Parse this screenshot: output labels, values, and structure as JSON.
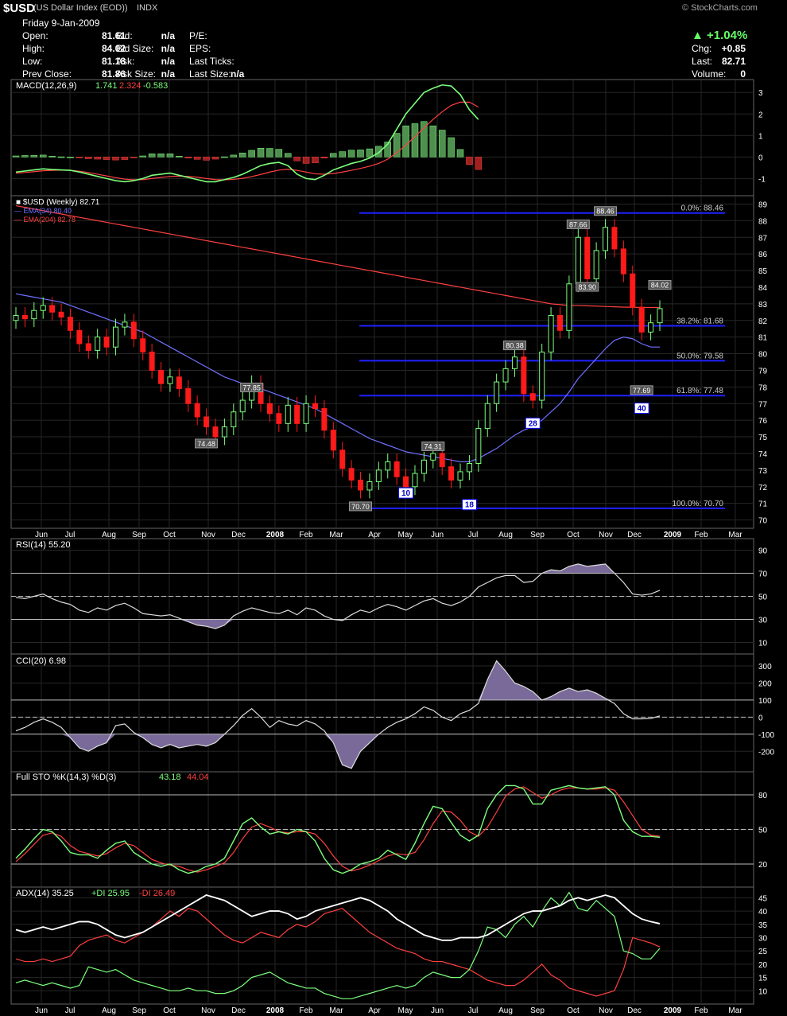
{
  "header": {
    "symbol": "$USD",
    "name": "(US Dollar Index (EOD))",
    "exchange": "INDX",
    "source": "© StockCharts.com",
    "date": "Friday  9-Jan-2009",
    "col1": [
      [
        "Open:",
        "81.61"
      ],
      [
        "High:",
        "84.02"
      ],
      [
        "Low:",
        "81.18"
      ],
      [
        "Prev Close:",
        "81.86"
      ]
    ],
    "col2": [
      [
        "Bid:",
        "n/a"
      ],
      [
        "Bid Size:",
        "n/a"
      ],
      [
        "Ask:",
        "n/a"
      ],
      [
        "Ask Size:",
        "n/a"
      ]
    ],
    "col3": [
      [
        "P/E:",
        ""
      ],
      [
        "EPS:",
        ""
      ],
      [
        "Last Ticks:",
        ""
      ],
      [
        "Last Size:",
        "n/a"
      ]
    ],
    "change_pct": "+1.04%",
    "right": [
      [
        "Chg:",
        "+0.85"
      ],
      [
        "Last:",
        "82.71"
      ],
      [
        "Volume:",
        "0"
      ]
    ]
  },
  "colors": {
    "up": "#7cff7c",
    "down": "#ff1a1a",
    "ema34": "#7070ff",
    "ema204": "#ff4040",
    "fib": "#2020ff",
    "purple": "#7a6a9a"
  },
  "chart_data": [
    {
      "type": "line",
      "title": "MACD(12,26,9)",
      "values_label": [
        "1.741",
        "2.324",
        "-0.583"
      ],
      "ylim": [
        -1.8,
        3.6
      ],
      "yticks": [
        -1,
        0,
        1,
        2,
        3
      ],
      "macd": [
        -0.7,
        -0.65,
        -0.6,
        -0.55,
        -0.58,
        -0.6,
        -0.62,
        -0.7,
        -0.8,
        -0.9,
        -1.0,
        -1.1,
        -1.15,
        -1.1,
        -1.0,
        -0.85,
        -0.8,
        -0.75,
        -0.85,
        -0.95,
        -1.05,
        -1.15,
        -1.15,
        -1.05,
        -0.95,
        -0.8,
        -0.6,
        -0.4,
        -0.3,
        -0.25,
        -0.4,
        -0.8,
        -1.0,
        -1.05,
        -0.85,
        -0.6,
        -0.45,
        -0.3,
        -0.2,
        -0.05,
        0.2,
        0.6,
        1.3,
        2.0,
        2.5,
        3.0,
        3.2,
        3.35,
        3.3,
        2.9,
        2.2,
        1.741
      ],
      "signal": [
        -0.75,
        -0.72,
        -0.68,
        -0.64,
        -0.62,
        -0.61,
        -0.62,
        -0.66,
        -0.72,
        -0.8,
        -0.88,
        -0.96,
        -1.03,
        -1.06,
        -1.05,
        -1.0,
        -0.95,
        -0.9,
        -0.89,
        -0.9,
        -0.94,
        -1.0,
        -1.05,
        -1.06,
        -1.04,
        -0.99,
        -0.91,
        -0.81,
        -0.7,
        -0.61,
        -0.57,
        -0.62,
        -0.7,
        -0.78,
        -0.8,
        -0.77,
        -0.7,
        -0.62,
        -0.53,
        -0.43,
        -0.3,
        -0.1,
        0.2,
        0.55,
        0.95,
        1.35,
        1.75,
        2.1,
        2.4,
        2.55,
        2.55,
        2.324
      ]
    },
    {
      "type": "candlestick",
      "title": "$USD (Weekly) 82.71",
      "series": [
        {
          "name": "EMA(34) 80.40",
          "color": "#7070ff"
        },
        {
          "name": "EMA(204) 82.78",
          "color": "#ff4040"
        }
      ],
      "ylim": [
        69.5,
        89.5
      ],
      "yticks": [
        70,
        71,
        72,
        73,
        74,
        75,
        76,
        77,
        78,
        79,
        80,
        81,
        82,
        83,
        84,
        85,
        86,
        87,
        88,
        89
      ],
      "xticks": [
        "Jun",
        "Jul",
        "Aug",
        "Sep",
        "Oct",
        "Nov",
        "Dec",
        "2008",
        "Feb",
        "Mar",
        "Apr",
        "May",
        "Jun",
        "Jul",
        "Aug",
        "Sep",
        "Oct",
        "Nov",
        "Dec",
        "2009",
        "Feb",
        "Mar"
      ],
      "closes": [
        82.3,
        82.1,
        82.6,
        82.9,
        82.5,
        82.2,
        81.4,
        80.6,
        80.2,
        81.0,
        80.4,
        81.6,
        81.9,
        80.9,
        80.1,
        79.0,
        78.2,
        78.6,
        77.9,
        77.0,
        76.2,
        75.6,
        75.0,
        75.6,
        76.5,
        77.2,
        78.2,
        77.0,
        76.4,
        75.8,
        76.9,
        75.8,
        77.0,
        76.7,
        75.4,
        74.2,
        73.1,
        72.4,
        71.8,
        72.3,
        73.0,
        73.5,
        72.6,
        72.0,
        72.8,
        73.6,
        74.0,
        73.2,
        72.4,
        72.9,
        73.4,
        75.5,
        77.0,
        78.3,
        79.1,
        79.8,
        77.6,
        77.2,
        80.1,
        82.3,
        81.4,
        84.2,
        87.0,
        84.5,
        86.2,
        87.6,
        86.3,
        84.8,
        82.8,
        81.3,
        81.86,
        82.71
      ],
      "ema34": [
        83.6,
        83.5,
        83.4,
        83.3,
        83.2,
        83.1,
        82.9,
        82.7,
        82.5,
        82.3,
        82.1,
        81.9,
        81.7,
        81.5,
        81.3,
        81.0,
        80.7,
        80.4,
        80.1,
        79.8,
        79.5,
        79.2,
        78.9,
        78.6,
        78.4,
        78.2,
        78.1,
        77.9,
        77.7,
        77.5,
        77.3,
        77.1,
        76.9,
        76.7,
        76.4,
        76.1,
        75.8,
        75.5,
        75.2,
        74.9,
        74.7,
        74.5,
        74.3,
        74.1,
        74.0,
        73.9,
        73.8,
        73.7,
        73.6,
        73.5,
        73.5,
        73.7,
        74.0,
        74.3,
        74.7,
        75.1,
        75.4,
        75.6,
        76.0,
        76.5,
        77.0,
        77.7,
        78.5,
        79.1,
        79.7,
        80.3,
        80.8,
        81.0,
        80.9,
        80.6,
        80.4,
        80.4
      ],
      "ema204": [
        88.9,
        88.8,
        88.7,
        88.6,
        88.5,
        88.4,
        88.3,
        88.2,
        88.1,
        88.0,
        87.9,
        87.8,
        87.7,
        87.6,
        87.5,
        87.4,
        87.3,
        87.2,
        87.1,
        87.0,
        86.9,
        86.8,
        86.7,
        86.6,
        86.5,
        86.4,
        86.3,
        86.2,
        86.1,
        86.0,
        85.9,
        85.8,
        85.7,
        85.6,
        85.5,
        85.4,
        85.3,
        85.2,
        85.1,
        85.0,
        84.9,
        84.8,
        84.7,
        84.6,
        84.5,
        84.4,
        84.3,
        84.2,
        84.1,
        84.0,
        83.9,
        83.8,
        83.7,
        83.6,
        83.5,
        83.4,
        83.3,
        83.2,
        83.1,
        83.0,
        82.95,
        82.9,
        82.9,
        82.88,
        82.86,
        82.84,
        82.82,
        82.8,
        82.79,
        82.78,
        82.78,
        82.78
      ],
      "fib_levels": [
        {
          "label": "0.0%: 88.46",
          "value": 88.46
        },
        {
          "label": "38.2%: 81.68",
          "value": 81.68
        },
        {
          "label": "50.0%: 79.58",
          "value": 79.58
        },
        {
          "label": "61.8%: 77.48",
          "value": 77.48
        },
        {
          "label": "100.0%: 70.70",
          "value": 70.7
        }
      ],
      "annotations": [
        {
          "text": "77.85",
          "idx": 26,
          "value": 77.85
        },
        {
          "text": "74.48",
          "idx": 21,
          "value": 74.48
        },
        {
          "text": "70.70",
          "idx": 38,
          "value": 70.7
        },
        {
          "text": "74.31",
          "idx": 46,
          "value": 74.31
        },
        {
          "text": "80.38",
          "idx": 55,
          "value": 80.38
        },
        {
          "text": "87.66",
          "idx": 62,
          "value": 87.66
        },
        {
          "text": "88.46",
          "idx": 65,
          "value": 88.46
        },
        {
          "text": "83.90",
          "idx": 63,
          "value": 83.9
        },
        {
          "text": "84.02",
          "idx": 71,
          "value": 84.02
        },
        {
          "text": "77.69",
          "idx": 69,
          "value": 77.69
        }
      ],
      "markers": [
        {
          "text": "10",
          "idx": 43,
          "value": 71.6
        },
        {
          "text": "18",
          "idx": 50,
          "value": 70.9
        },
        {
          "text": "28",
          "idx": 57,
          "value": 75.8
        },
        {
          "text": "40",
          "idx": 69,
          "value": 76.7
        }
      ]
    },
    {
      "type": "line",
      "title": "RSI(14)",
      "value_label": "55.20",
      "ylim": [
        0,
        100
      ],
      "yticks": [
        10,
        30,
        50,
        70,
        90
      ],
      "values": [
        49,
        48,
        50,
        52,
        48,
        45,
        43,
        38,
        36,
        40,
        38,
        42,
        44,
        40,
        35,
        34,
        33,
        34,
        31,
        28,
        25,
        24,
        22,
        25,
        33,
        37,
        40,
        38,
        36,
        35,
        38,
        34,
        40,
        38,
        33,
        30,
        29,
        34,
        38,
        36,
        40,
        43,
        41,
        38,
        42,
        46,
        48,
        44,
        42,
        45,
        50,
        58,
        62,
        66,
        68,
        68,
        62,
        63,
        70,
        73,
        72,
        76,
        78,
        76,
        77,
        78,
        70,
        62,
        52,
        51,
        52,
        55.2
      ]
    },
    {
      "type": "line",
      "title": "CCI(20)",
      "value_label": "6.98",
      "ylim": [
        -320,
        370
      ],
      "yticks": [
        -200,
        -100,
        0,
        100,
        200,
        300
      ],
      "values": [
        -80,
        -60,
        -30,
        -10,
        -30,
        -60,
        -120,
        -180,
        -200,
        -170,
        -150,
        -50,
        -40,
        -90,
        -120,
        -160,
        -180,
        -160,
        -180,
        -170,
        -160,
        -170,
        -150,
        -100,
        -50,
        10,
        50,
        0,
        -60,
        -20,
        -40,
        -50,
        -20,
        -40,
        -80,
        -150,
        -280,
        -300,
        -200,
        -150,
        -100,
        -60,
        -30,
        -10,
        20,
        60,
        40,
        0,
        -20,
        20,
        40,
        80,
        220,
        330,
        270,
        200,
        180,
        150,
        100,
        120,
        150,
        170,
        150,
        160,
        140,
        110,
        80,
        20,
        -10,
        -10,
        -8,
        6.98
      ]
    },
    {
      "type": "line",
      "title": "Full STO %K(14,3) %D(3)",
      "values_label": [
        "43.18",
        "44.04"
      ],
      "ylim": [
        0,
        100
      ],
      "yticks": [
        20,
        50,
        80
      ],
      "k": [
        25,
        33,
        42,
        50,
        48,
        40,
        30,
        28,
        28,
        25,
        32,
        38,
        40,
        30,
        25,
        20,
        18,
        20,
        15,
        12,
        14,
        18,
        20,
        25,
        40,
        55,
        60,
        52,
        46,
        48,
        46,
        50,
        48,
        40,
        25,
        15,
        12,
        15,
        20,
        22,
        25,
        32,
        28,
        24,
        38,
        55,
        70,
        68,
        56,
        45,
        40,
        45,
        68,
        80,
        88,
        88,
        85,
        72,
        72,
        84,
        86,
        88,
        86,
        85,
        86,
        87,
        80,
        58,
        48,
        44,
        44,
        43.18
      ],
      "d": [
        22,
        29,
        37,
        45,
        47,
        44,
        36,
        31,
        29,
        27,
        29,
        34,
        38,
        36,
        30,
        24,
        21,
        19,
        18,
        15,
        13,
        15,
        18,
        21,
        30,
        42,
        52,
        55,
        52,
        48,
        47,
        48,
        48,
        46,
        38,
        27,
        18,
        14,
        16,
        19,
        23,
        27,
        29,
        28,
        30,
        41,
        55,
        66,
        65,
        58,
        48,
        44,
        52,
        65,
        79,
        85,
        87,
        82,
        77,
        80,
        84,
        86,
        86,
        85,
        85,
        86,
        84,
        74,
        62,
        50,
        45,
        44.04
      ]
    },
    {
      "type": "line",
      "title": "ADX(14)",
      "values_label": [
        "35.25",
        "25.95",
        "26.49"
      ],
      "series": [
        {
          "name": "+DI",
          "color": "#7cff7c"
        },
        {
          "name": "-DI",
          "color": "#ff4040"
        }
      ],
      "ylim": [
        5,
        49
      ],
      "yticks": [
        10,
        15,
        20,
        25,
        30,
        35,
        40,
        45
      ],
      "adx": [
        33,
        32,
        33,
        34,
        33,
        34,
        35,
        36,
        36,
        35,
        33,
        31,
        30,
        31,
        32,
        34,
        36,
        38,
        40,
        42,
        44,
        46,
        45,
        44,
        42,
        40,
        38,
        39,
        40,
        40,
        39,
        37,
        38,
        40,
        41,
        42,
        43,
        44,
        45,
        44,
        42,
        40,
        37,
        35,
        33,
        31,
        30,
        29,
        29,
        30,
        30,
        30,
        31,
        33,
        35,
        37,
        39,
        40,
        40,
        41,
        42,
        44,
        45,
        44,
        45,
        46,
        45,
        42,
        39,
        37,
        36,
        35.25
      ],
      "pdi": [
        13,
        14,
        13,
        12,
        13,
        12,
        11,
        12,
        19,
        18,
        17,
        18,
        16,
        14,
        13,
        12,
        11,
        10,
        10,
        11,
        10,
        10,
        9,
        9,
        10,
        12,
        15,
        16,
        17,
        15,
        13,
        12,
        11,
        11,
        9,
        8,
        7,
        7,
        8,
        9,
        10,
        11,
        12,
        11,
        12,
        15,
        17,
        16,
        15,
        15,
        18,
        25,
        34,
        33,
        30,
        35,
        38,
        34,
        40,
        45,
        42,
        47,
        41,
        40,
        44,
        41,
        38,
        25,
        24,
        22,
        22,
        25.95
      ],
      "mdi": [
        22,
        21,
        21,
        22,
        21,
        22,
        23,
        27,
        29,
        30,
        31,
        29,
        28,
        30,
        32,
        34,
        37,
        40,
        38,
        41,
        40,
        37,
        34,
        31,
        29,
        28,
        30,
        32,
        31,
        30,
        33,
        35,
        34,
        36,
        39,
        40,
        41,
        38,
        35,
        32,
        30,
        28,
        26,
        25,
        24,
        22,
        21,
        21,
        20,
        19,
        18,
        16,
        14,
        13,
        12,
        12,
        14,
        17,
        20,
        16,
        14,
        11,
        10,
        9,
        8,
        9,
        10,
        18,
        30,
        29,
        28,
        26.49
      ]
    }
  ]
}
